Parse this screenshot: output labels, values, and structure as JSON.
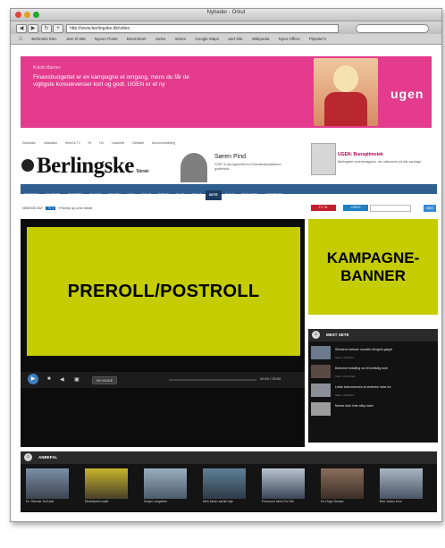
{
  "window": {
    "title": "Nyheder - Orkut"
  },
  "browser": {
    "url": "http://www.berlingske.dk/video",
    "bookmarks": [
      "Berlinske Eikc",
      "Jam til 366",
      "Nyeuo Poste",
      "Betonitreet",
      "ranke",
      "Indvre",
      "Google Maps",
      "and Xikt",
      "Wikipedia",
      "Nyeo Offers",
      "Flipotter's"
    ]
  },
  "ad_top": {
    "kicker": "Kolofs Barner:",
    "text": "Finansbudgettet er en kampagne et omgang, mens du får de vigtigste konsekvenser kort og godt. UGEN er et ny",
    "brand": "ugen",
    "bg_color": "#e43b8e"
  },
  "topnav": {
    "items": [
      "Stadsdlar",
      "Indzsfator",
      "Mobil & Tv",
      "Hr",
      "Ho",
      "Lokalredt",
      "Debatlet",
      "Annonceafdeling"
    ]
  },
  "logo": {
    "text": "Berlingske",
    "tagline": "Tidende"
  },
  "promo": {
    "title": "Søren Pind",
    "subtitle": "FORT & ass agarmtlid fra Enhedslistepolitikeren godbehold"
  },
  "promo2": {
    "title": "UGEN: Bunsgtimotek",
    "subtitle": "Berlingsket nyhedsmagazin, der udkommer på alle søndage"
  },
  "mainnav": {
    "items": [
      "FORSIDE",
      "NYHEDER",
      "SPORTEN",
      "BLOGS",
      "POLITIK",
      "AOK",
      "PHLIE",
      "DEBAT",
      "BLOG",
      "BOLIG",
      "NOTE",
      "SMAG"
    ],
    "active": "NOTE",
    "extra": [
      "BOSAGER",
      "LIBRERNET"
    ]
  },
  "crumb": {
    "label": "NIBESDE.BAY",
    "tag": "TV 2",
    "title": "»Fidelig! og Levle Ibelde"
  },
  "controls": {
    "red": "TV TIL",
    "blue": "VIDEO",
    "go": "SØG"
  },
  "player": {
    "hd": "HD MODE",
    "time": "00:00 / 00:00"
  },
  "preroll": {
    "label": "PREROLL/POSTROLL"
  },
  "banner": {
    "line1": "KAMPAGNE-",
    "line2": "BANNER"
  },
  "most_viewed": {
    "title": "MEST SETE",
    "items": [
      {
        "text": "Slimbeon loebam nnucleh dlergels galget",
        "meta": "Sted: 1.04 Plam"
      },
      {
        "text": "Bohemet fortalling om til fortfarlig buhl",
        "meta": "Sted: 13.02 Plam"
      },
      {
        "text": "Letlar loekommmes al sedrerke mine fra",
        "meta": "Sted: 1.00 Plam"
      },
      {
        "text": "Meese fotol hote stihp baier",
        "meta": ""
      }
    ]
  },
  "related": {
    "title": "ANBEFAL",
    "items": [
      {
        "caption": "Dr. Rhenier Soll sett"
      },
      {
        "caption": "Dindelpelrn toald"
      },
      {
        "caption": "Sonjel Langelirer"
      },
      {
        "caption": "Meh beher sarhie laje"
      },
      {
        "caption": "Fremsom heriu Fer Sie"
      },
      {
        "caption": "Dv Hugo Dewan"
      },
      {
        "caption": "Ben Vokku Kvm"
      }
    ]
  },
  "colors": {
    "lime": "#c5cc00",
    "nav_blue": "#2f5f8f",
    "player_bg": "#0c0c0c"
  }
}
